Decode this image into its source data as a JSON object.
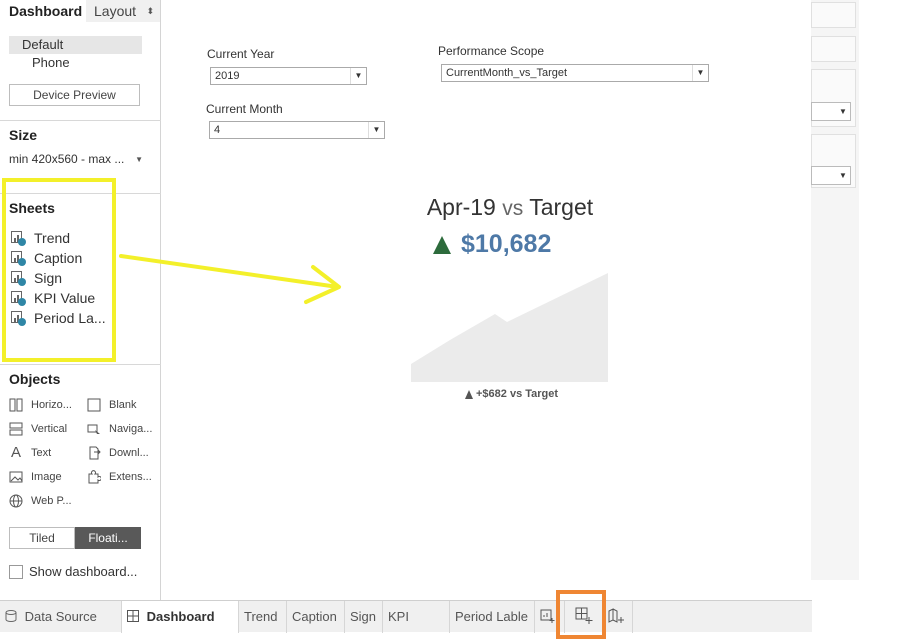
{
  "left_panel": {
    "tabs": {
      "dashboard": "Dashboard",
      "layout": "Layout",
      "layout_arrows": "⬍"
    },
    "devices": {
      "default": "Default",
      "phone": "Phone",
      "preview_button": "Device Preview"
    },
    "size": {
      "title": "Size",
      "value": "min 420x560 - max ...",
      "caret": "▼"
    },
    "sheets": {
      "title": "Sheets",
      "items": [
        "Trend",
        "Caption",
        "Sign",
        "KPI Value",
        "Period La..."
      ]
    },
    "objects": {
      "title": "Objects",
      "items": [
        {
          "label": "Horizo...",
          "icon": "horizontal-container-icon"
        },
        {
          "label": "Blank",
          "icon": "blank-icon"
        },
        {
          "label": "Vertical",
          "icon": "vertical-container-icon"
        },
        {
          "label": "Naviga...",
          "icon": "navigation-icon"
        },
        {
          "label": "Text",
          "icon": "text-icon"
        },
        {
          "label": "Downl...",
          "icon": "download-icon"
        },
        {
          "label": "Image",
          "icon": "image-icon"
        },
        {
          "label": "Extens...",
          "icon": "extension-icon"
        },
        {
          "label": "Web P...",
          "icon": "web-page-icon"
        }
      ]
    },
    "layout_mode": {
      "tiled": "Tiled",
      "floating": "Floati..."
    },
    "show_dashboard_title": "Show dashboard..."
  },
  "filters": {
    "current_year": {
      "label": "Current Year",
      "value": "2019"
    },
    "current_month": {
      "label": "Current Month",
      "value": "4"
    },
    "performance_scope": {
      "label": "Performance Scope",
      "value": "CurrentMonth_vs_Target"
    }
  },
  "kpi": {
    "period": "Apr-19",
    "vs": "vs",
    "target": "Target",
    "value": "$10,682",
    "caption": "+$682 vs Target",
    "colors": {
      "value": "#4e79a7",
      "up_arrow": "#2d6b3c",
      "area": "#ebebeb"
    }
  },
  "bottom_tabs": {
    "data_source": "Data Source",
    "tabs": [
      "Dashboard KPI",
      "Trend",
      "Caption",
      "Sign",
      "KPI Value",
      "Period Lable"
    ],
    "active": "Dashboard KPI"
  },
  "annotations": {
    "highlight_color": "#f3f02a",
    "orange_box_color": "#ef8633"
  }
}
